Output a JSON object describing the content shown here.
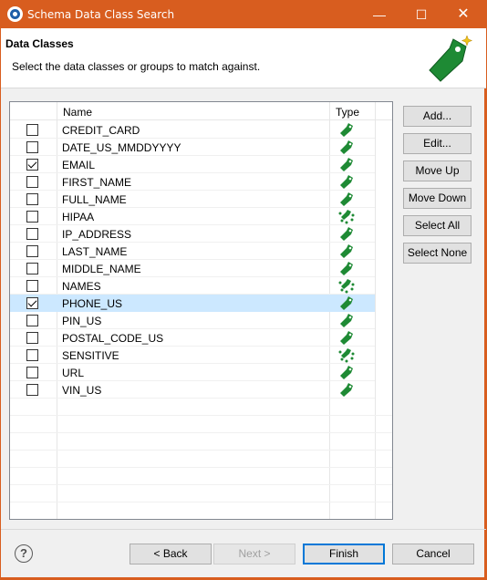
{
  "window": {
    "title": "Schema Data Class Search",
    "minimize_glyph": "—",
    "maximize_glyph": "☐",
    "close_glyph": "✕"
  },
  "banner": {
    "title": "Data Classes",
    "description": "Select the data classes or groups to match against.",
    "icon": "green-tag-sparkle-icon"
  },
  "table": {
    "columns": [
      "Name",
      "Type"
    ],
    "rows": [
      {
        "name": "CREDIT_CARD",
        "checked": false,
        "type": "class"
      },
      {
        "name": "DATE_US_MMDDYYYY",
        "checked": false,
        "type": "class"
      },
      {
        "name": "EMAIL",
        "checked": true,
        "type": "class"
      },
      {
        "name": "FIRST_NAME",
        "checked": false,
        "type": "class"
      },
      {
        "name": "FULL_NAME",
        "checked": false,
        "type": "class"
      },
      {
        "name": "HIPAA",
        "checked": false,
        "type": "group"
      },
      {
        "name": "IP_ADDRESS",
        "checked": false,
        "type": "class"
      },
      {
        "name": "LAST_NAME",
        "checked": false,
        "type": "class"
      },
      {
        "name": "MIDDLE_NAME",
        "checked": false,
        "type": "class"
      },
      {
        "name": "NAMES",
        "checked": false,
        "type": "group"
      },
      {
        "name": "PHONE_US",
        "checked": true,
        "type": "class",
        "selected": true
      },
      {
        "name": "PIN_US",
        "checked": false,
        "type": "class"
      },
      {
        "name": "POSTAL_CODE_US",
        "checked": false,
        "type": "class"
      },
      {
        "name": "SENSITIVE",
        "checked": false,
        "type": "group"
      },
      {
        "name": "URL",
        "checked": false,
        "type": "class"
      },
      {
        "name": "VIN_US",
        "checked": false,
        "type": "class"
      }
    ]
  },
  "side_buttons": {
    "add": "Add...",
    "edit": "Edit...",
    "move_up": "Move Up",
    "move_down": "Move Down",
    "select_all": "Select All",
    "select_none": "Select None"
  },
  "footer": {
    "help": "?",
    "back": "< Back",
    "next": "Next >",
    "finish": "Finish",
    "cancel": "Cancel"
  },
  "colors": {
    "titlebar": "#d85d1f",
    "tag_green": "#1e8a34",
    "selection": "#cce8ff"
  }
}
